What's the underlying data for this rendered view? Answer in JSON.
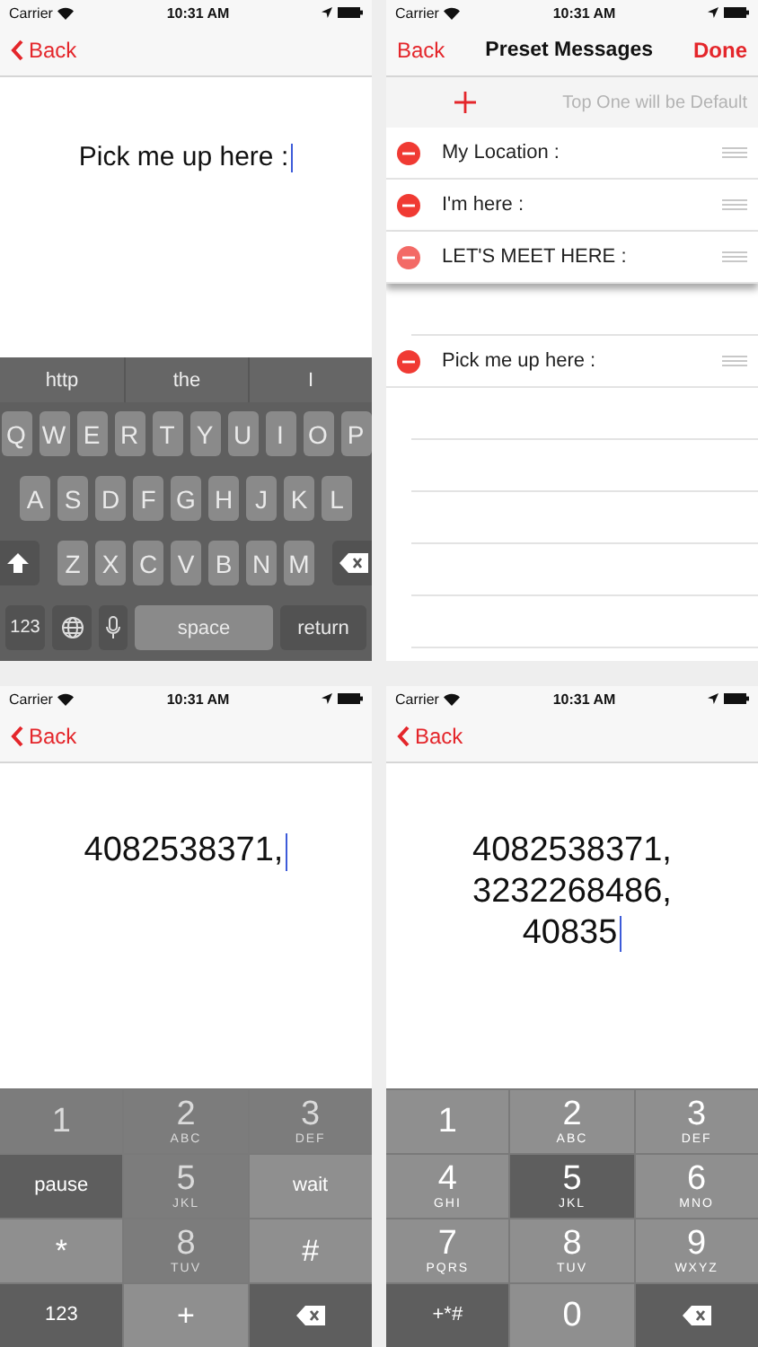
{
  "screens": [
    {
      "kind": "editor",
      "status": {
        "carrier": "Carrier",
        "time": "10:31 AM"
      },
      "nav": {
        "back": "Back"
      },
      "lines": [
        "Pick me up here :"
      ],
      "keyboard": {
        "kind": "qwerty",
        "suggestions": [
          "http",
          "the",
          "I"
        ],
        "rows": [
          [
            "Q",
            "W",
            "E",
            "R",
            "T",
            "Y",
            "U",
            "I",
            "O",
            "P"
          ],
          [
            "A",
            "S",
            "D",
            "F",
            "G",
            "H",
            "J",
            "K",
            "L"
          ],
          [
            "Z",
            "X",
            "C",
            "V",
            "B",
            "N",
            "M"
          ]
        ],
        "mode_key": "123",
        "space": "space",
        "return": "return"
      }
    },
    {
      "kind": "list",
      "status": {
        "carrier": "Carrier",
        "time": "10:31 AM"
      },
      "nav": {
        "back": "Back",
        "title": "Preset Messages",
        "done": "Done"
      },
      "hint": "Top One will be Default",
      "items": [
        {
          "text": "My Location :",
          "dragging": false
        },
        {
          "text": "I'm here :",
          "dragging": false
        },
        {
          "text": "LET'S MEET HERE :",
          "dragging": true
        },
        {
          "text": "Pick me up here :",
          "dragging": false
        }
      ]
    },
    {
      "kind": "editor",
      "status": {
        "carrier": "Carrier",
        "time": "10:31 AM"
      },
      "nav": {
        "back": "Back"
      },
      "lines": [
        "4082538371,"
      ],
      "keyboard": {
        "kind": "phone",
        "keys": [
          {
            "kind": "digit",
            "label": "1",
            "disabled": true,
            "dark": false
          },
          {
            "kind": "digit",
            "label": "2",
            "letters": "ABC",
            "disabled": true,
            "dark": false
          },
          {
            "kind": "digit",
            "label": "3",
            "letters": "DEF",
            "disabled": true,
            "dark": false
          },
          {
            "kind": "text",
            "label": "pause",
            "disabled": false,
            "dark": true
          },
          {
            "kind": "digit",
            "label": "5",
            "letters": "JKL",
            "disabled": true,
            "dark": false
          },
          {
            "kind": "text",
            "label": "wait",
            "disabled": false,
            "dark": false
          },
          {
            "kind": "symbol",
            "label": "*",
            "disabled": false,
            "dark": false
          },
          {
            "kind": "digit",
            "label": "8",
            "letters": "TUV",
            "disabled": true,
            "dark": false
          },
          {
            "kind": "symbol",
            "label": "#",
            "disabled": false,
            "dark": false
          },
          {
            "kind": "text",
            "label": "123",
            "disabled": false,
            "dark": true
          },
          {
            "kind": "symbol",
            "label": "+",
            "disabled": false,
            "dark": false
          },
          {
            "kind": "delete",
            "disabled": false,
            "dark": true
          }
        ]
      }
    },
    {
      "kind": "editor",
      "status": {
        "carrier": "Carrier",
        "time": "10:31 AM"
      },
      "nav": {
        "back": "Back"
      },
      "lines": [
        "4082538371,",
        "3232268486,",
        "40835"
      ],
      "keyboard": {
        "kind": "phone",
        "keys": [
          {
            "kind": "digit",
            "label": "1",
            "disabled": false,
            "dark": false
          },
          {
            "kind": "digit",
            "label": "2",
            "letters": "ABC",
            "disabled": false,
            "dark": false
          },
          {
            "kind": "digit",
            "label": "3",
            "letters": "DEF",
            "disabled": false,
            "dark": false
          },
          {
            "kind": "digit",
            "label": "4",
            "letters": "GHI",
            "disabled": false,
            "dark": false
          },
          {
            "kind": "digit",
            "label": "5",
            "letters": "JKL",
            "disabled": false,
            "dark": true
          },
          {
            "kind": "digit",
            "label": "6",
            "letters": "MNO",
            "disabled": false,
            "dark": false
          },
          {
            "kind": "digit",
            "label": "7",
            "letters": "PQRS",
            "disabled": false,
            "dark": false
          },
          {
            "kind": "digit",
            "label": "8",
            "letters": "TUV",
            "disabled": false,
            "dark": false
          },
          {
            "kind": "digit",
            "label": "9",
            "letters": "WXYZ",
            "disabled": false,
            "dark": false
          },
          {
            "kind": "text",
            "label": "+*#",
            "disabled": false,
            "dark": true
          },
          {
            "kind": "digit",
            "label": "0",
            "disabled": false,
            "dark": false
          },
          {
            "kind": "delete",
            "disabled": false,
            "dark": true
          }
        ]
      }
    }
  ]
}
